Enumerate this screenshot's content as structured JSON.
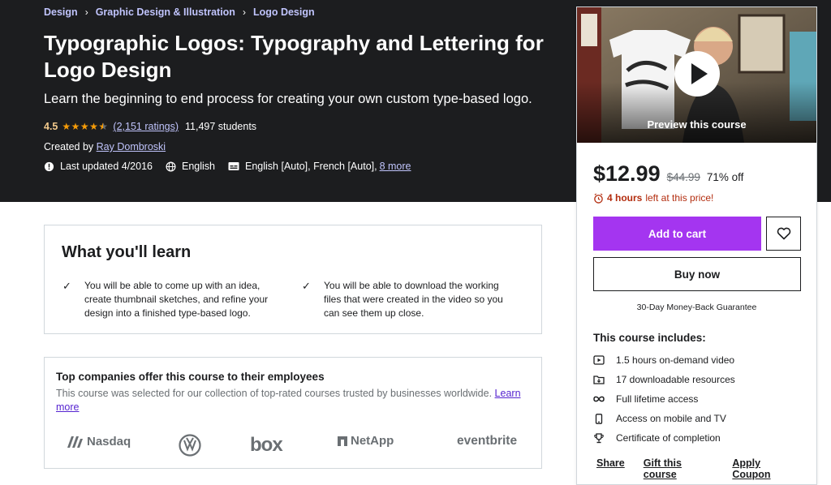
{
  "breadcrumb": [
    "Design",
    "Graphic Design & Illustration",
    "Logo Design"
  ],
  "course": {
    "title": "Typographic Logos: Typography and Lettering for Logo Design",
    "subtitle": "Learn the beginning to end process for creating your own custom type-based logo.",
    "rating": "4.5",
    "rating_value": 4.5,
    "ratings_count": "(2,151 ratings)",
    "students": "11,497 students",
    "created_by_label": "Created by",
    "instructor": "Ray Dombroski",
    "last_updated": "Last updated 4/2016",
    "language": "English",
    "captions": "English [Auto], French [Auto],",
    "captions_more": "8 more"
  },
  "learn": {
    "title": "What you'll learn",
    "items": [
      "You will be able to come up with an idea, create thumbnail sketches, and refine your design into a finished type-based logo.",
      "You will be able to download the working files that were created in the video so you can see them up close."
    ]
  },
  "companies": {
    "title": "Top companies offer this course to their employees",
    "description": "This course was selected for our collection of top-rated courses trusted by businesses worldwide.",
    "learn_more": "Learn more",
    "logos": [
      "Nasdaq",
      "Volkswagen",
      "box",
      "NetApp",
      "eventbrite"
    ]
  },
  "sidebar": {
    "preview_label": "Preview this course",
    "price": "$12.99",
    "original_price": "$44.99",
    "discount": "71% off",
    "timer_hours": "4 hours",
    "timer_text": "left at this price!",
    "add_to_cart": "Add to cart",
    "buy_now": "Buy now",
    "guarantee": "30-Day Money-Back Guarantee",
    "includes_title": "This course includes:",
    "includes": [
      {
        "icon": "video-icon",
        "text": "1.5 hours on-demand video"
      },
      {
        "icon": "download-icon",
        "text": "17 downloadable resources"
      },
      {
        "icon": "infinity-icon",
        "text": "Full lifetime access"
      },
      {
        "icon": "mobile-icon",
        "text": "Access on mobile and TV"
      },
      {
        "icon": "trophy-icon",
        "text": "Certificate of completion"
      }
    ],
    "actions": [
      "Share",
      "Gift this course",
      "Apply Coupon"
    ]
  },
  "colors": {
    "hero_bg": "#1c1d1f",
    "accent_purple": "#a435f0",
    "link_lavender": "#c0c4fc",
    "star_orange": "#f69c08",
    "timer_red": "#b32d0f"
  }
}
